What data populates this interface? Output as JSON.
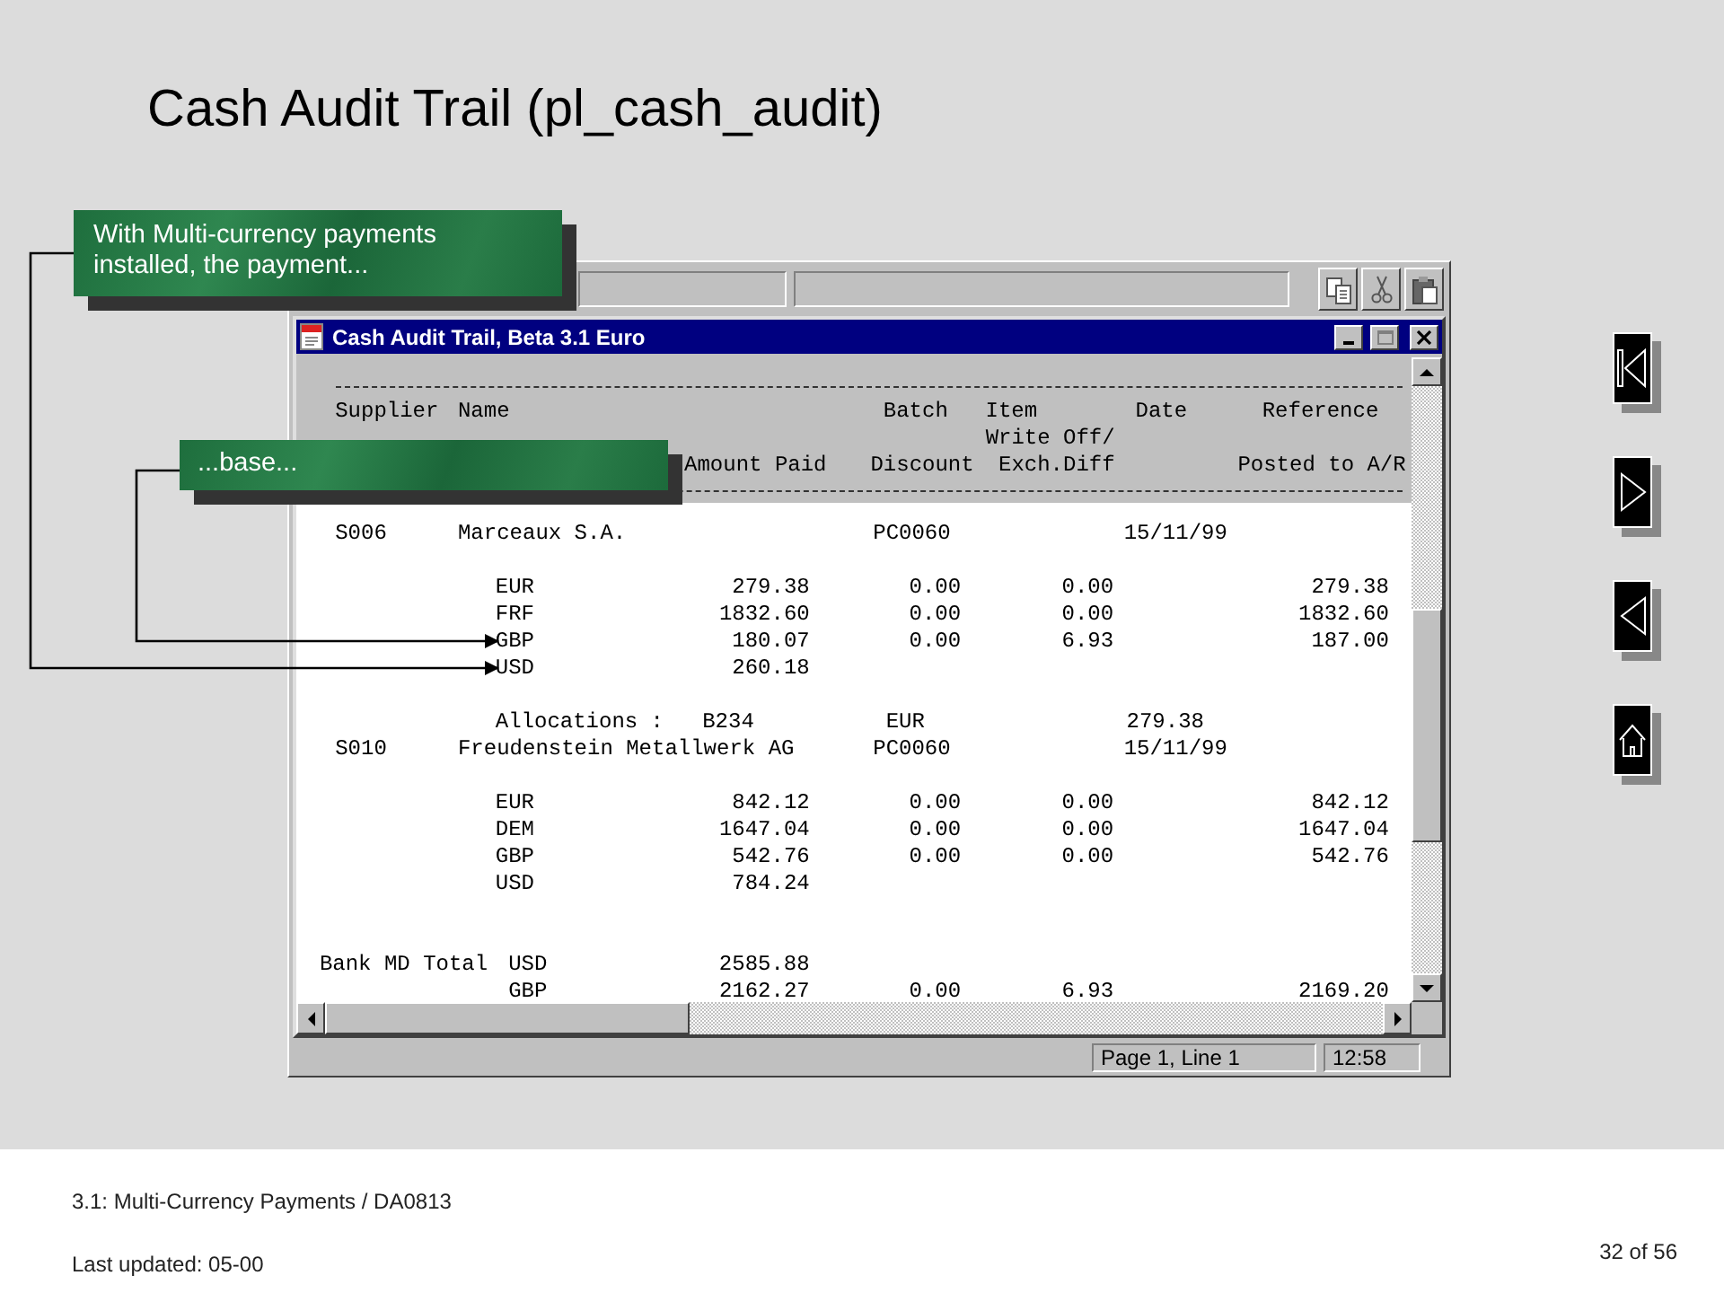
{
  "slide": {
    "title": "Cash Audit Trail (pl_cash_audit)"
  },
  "window": {
    "title": "Cash Audit Trail, Beta 3.1 Euro",
    "buttons": [
      {
        "kind": "minimize",
        "disabled": false
      },
      {
        "kind": "maximize",
        "disabled": true
      },
      {
        "kind": "close",
        "disabled": false
      }
    ]
  },
  "toolbar": {
    "buttons": [
      {
        "kind": "copy"
      },
      {
        "kind": "cut"
      },
      {
        "kind": "paste"
      }
    ]
  },
  "report": {
    "header_lines": [
      {
        "supplier": "Supplier",
        "name": "Name",
        "batch": "Batch",
        "item": "Item",
        "date": "Date",
        "reference": "Reference"
      },
      {
        "item": "Write Off/"
      },
      {
        "amount_paid": "Amount Paid",
        "discount": "Discount",
        "exch_diff": "Exch.Diff",
        "posted": "Posted to A/R"
      }
    ],
    "rows": [
      {
        "kind": "supplier",
        "supplier": "S006",
        "name": "Marceaux S.A.",
        "batch": "PC0060",
        "date": "15/11/99"
      },
      {
        "kind": "blank"
      },
      {
        "kind": "currency",
        "currency": "EUR",
        "amount_paid": "279.38",
        "discount": "0.00",
        "exch_diff": "0.00",
        "posted": "279.38"
      },
      {
        "kind": "currency",
        "currency": "FRF",
        "amount_paid": "1832.60",
        "discount": "0.00",
        "exch_diff": "0.00",
        "posted": "1832.60"
      },
      {
        "kind": "currency",
        "currency": "GBP",
        "amount_paid": "180.07",
        "discount": "0.00",
        "exch_diff": "6.93",
        "posted": "187.00"
      },
      {
        "kind": "currency",
        "currency": "USD",
        "amount_paid": "260.18"
      },
      {
        "kind": "blank"
      },
      {
        "kind": "allocation",
        "label": "Allocations :",
        "reference": "B234",
        "currency": "EUR",
        "amount": "279.38"
      },
      {
        "kind": "supplier",
        "supplier": "S010",
        "name": "Freudenstein Metallwerk AG",
        "batch": "PC0060",
        "date": "15/11/99"
      },
      {
        "kind": "blank"
      },
      {
        "kind": "currency",
        "currency": "EUR",
        "amount_paid": "842.12",
        "discount": "0.00",
        "exch_diff": "0.00",
        "posted": "842.12"
      },
      {
        "kind": "currency",
        "currency": "DEM",
        "amount_paid": "1647.04",
        "discount": "0.00",
        "exch_diff": "0.00",
        "posted": "1647.04"
      },
      {
        "kind": "currency",
        "currency": "GBP",
        "amount_paid": "542.76",
        "discount": "0.00",
        "exch_diff": "0.00",
        "posted": "542.76"
      },
      {
        "kind": "currency",
        "currency": "USD",
        "amount_paid": "784.24"
      },
      {
        "kind": "blank"
      },
      {
        "kind": "blank"
      },
      {
        "kind": "total",
        "label": "Bank MD Total",
        "currency": "USD",
        "amount_paid": "2585.88"
      },
      {
        "kind": "total",
        "currency": "GBP",
        "amount_paid": "2162.27",
        "discount": "0.00",
        "exch_diff": "6.93",
        "posted": "2169.20"
      }
    ]
  },
  "status_bar": [
    "Page 1, Line 1",
    "12:58"
  ],
  "callouts": [
    {
      "text": "With Multi-currency payments installed, the payment..."
    },
    {
      "text": "...base..."
    }
  ],
  "nav_buttons": [
    {
      "kind": "first"
    },
    {
      "kind": "next"
    },
    {
      "kind": "previous"
    },
    {
      "kind": "home"
    }
  ],
  "footer": {
    "course": "3.1: Multi-Currency Payments / DA0813",
    "updated": "Last updated: 05-00",
    "page": "32 of 56"
  }
}
